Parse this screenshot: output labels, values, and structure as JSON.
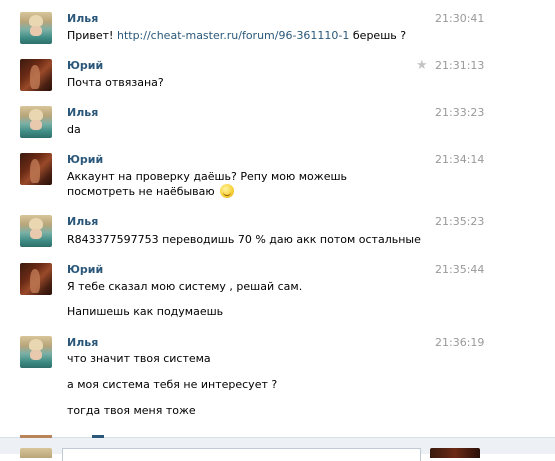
{
  "messages": [
    {
      "author": "Илья",
      "avatar": "ilya",
      "time": "21:30:41",
      "starred": false,
      "lines": [
        {
          "before": "Привет! ",
          "link": "http://cheat-master.ru/forum/96-361110-1",
          "after": " берешь ?"
        }
      ]
    },
    {
      "author": "Юрий",
      "avatar": "yuri",
      "time": "21:31:13",
      "starred": true,
      "lines": [
        {
          "text": "Почта отвязана?"
        }
      ]
    },
    {
      "author": "Илья",
      "avatar": "ilya",
      "time": "21:33:23",
      "starred": false,
      "lines": [
        {
          "text": "da"
        }
      ]
    },
    {
      "author": "Юрий",
      "avatar": "yuri",
      "time": "21:34:14",
      "starred": false,
      "lines": [
        {
          "text": "Аккаунт на проверку даёшь? Репу мою можешь посмотреть не наёбываю",
          "emoji": "wink-smiley"
        }
      ]
    },
    {
      "author": "Илья",
      "avatar": "ilya",
      "time": "21:35:23",
      "starred": false,
      "lines": [
        {
          "text": "R843377597753 переводишь 70 % даю акк потом остальные"
        }
      ]
    },
    {
      "author": "Юрий",
      "avatar": "yuri",
      "time": "21:35:44",
      "starred": false,
      "lines": [
        {
          "text": "Я тебе сказал мою систему , решай сам."
        },
        {
          "text": "Напишешь как подумаешь"
        }
      ]
    },
    {
      "author": "Илья",
      "avatar": "ilya",
      "time": "21:36:19",
      "starred": false,
      "lines": [
        {
          "text": "что значит твоя система"
        },
        {
          "text": "а моя система тебя не интересует ?"
        },
        {
          "text": "тогда твоя меня тоже"
        }
      ]
    }
  ],
  "icons": {
    "star": "star-icon",
    "emoji": "wink-smiley-icon"
  },
  "colors": {
    "author": "#2b587a",
    "link": "#2b587a",
    "time": "#999999",
    "star": "#c5c5c5",
    "composer_bg": "#edf1f5"
  }
}
